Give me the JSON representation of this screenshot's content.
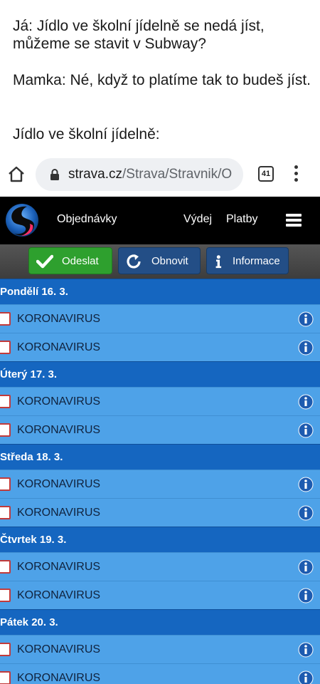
{
  "caption": {
    "line1": "Já: Jídlo ve školní jídelně se nedá jíst, můžeme se stavit v Subway?",
    "line2": "Mamka: Né, když to platíme tak to budeš jíst.",
    "line3": "Jídlo ve školní jídelně:"
  },
  "browser": {
    "url_domain": "strava.cz",
    "url_path": "/Strava/Stravnik/O",
    "tabs_count": "41",
    "icons": [
      "home-icon",
      "lock-icon",
      "kebab-menu-icon"
    ]
  },
  "header": {
    "nav_orders": "Objednávky",
    "nav_dispense": "Výdej",
    "nav_payments": "Platby",
    "icons": [
      "logo",
      "hamburger-menu-icon"
    ]
  },
  "toolbar": {
    "send_label": "Odeslat",
    "refresh_label": "Obnovit",
    "info_label": "Informace",
    "colors": {
      "send": "#2ea02e",
      "refresh": "#234e86",
      "info": "#234e86"
    }
  },
  "days": [
    {
      "label": "Pondělí 16. 3.",
      "items": [
        "KORONAVIRUS",
        "KORONAVIRUS"
      ]
    },
    {
      "label": "Úterý 17. 3.",
      "items": [
        "KORONAVIRUS",
        "KORONAVIRUS"
      ]
    },
    {
      "label": "Středa 18. 3.",
      "items": [
        "KORONAVIRUS",
        "KORONAVIRUS"
      ]
    },
    {
      "label": "Čtvrtek 19. 3.",
      "items": [
        "KORONAVIRUS",
        "KORONAVIRUS"
      ]
    },
    {
      "label": "Pátek 20. 3.",
      "items": [
        "KORONAVIRUS",
        "KORONAVIRUS"
      ]
    }
  ],
  "colors": {
    "day_header": "#1566c0",
    "item_row": "#4ea2e8",
    "checkbox_border": "#c23b3b",
    "app_header": "#000000"
  }
}
